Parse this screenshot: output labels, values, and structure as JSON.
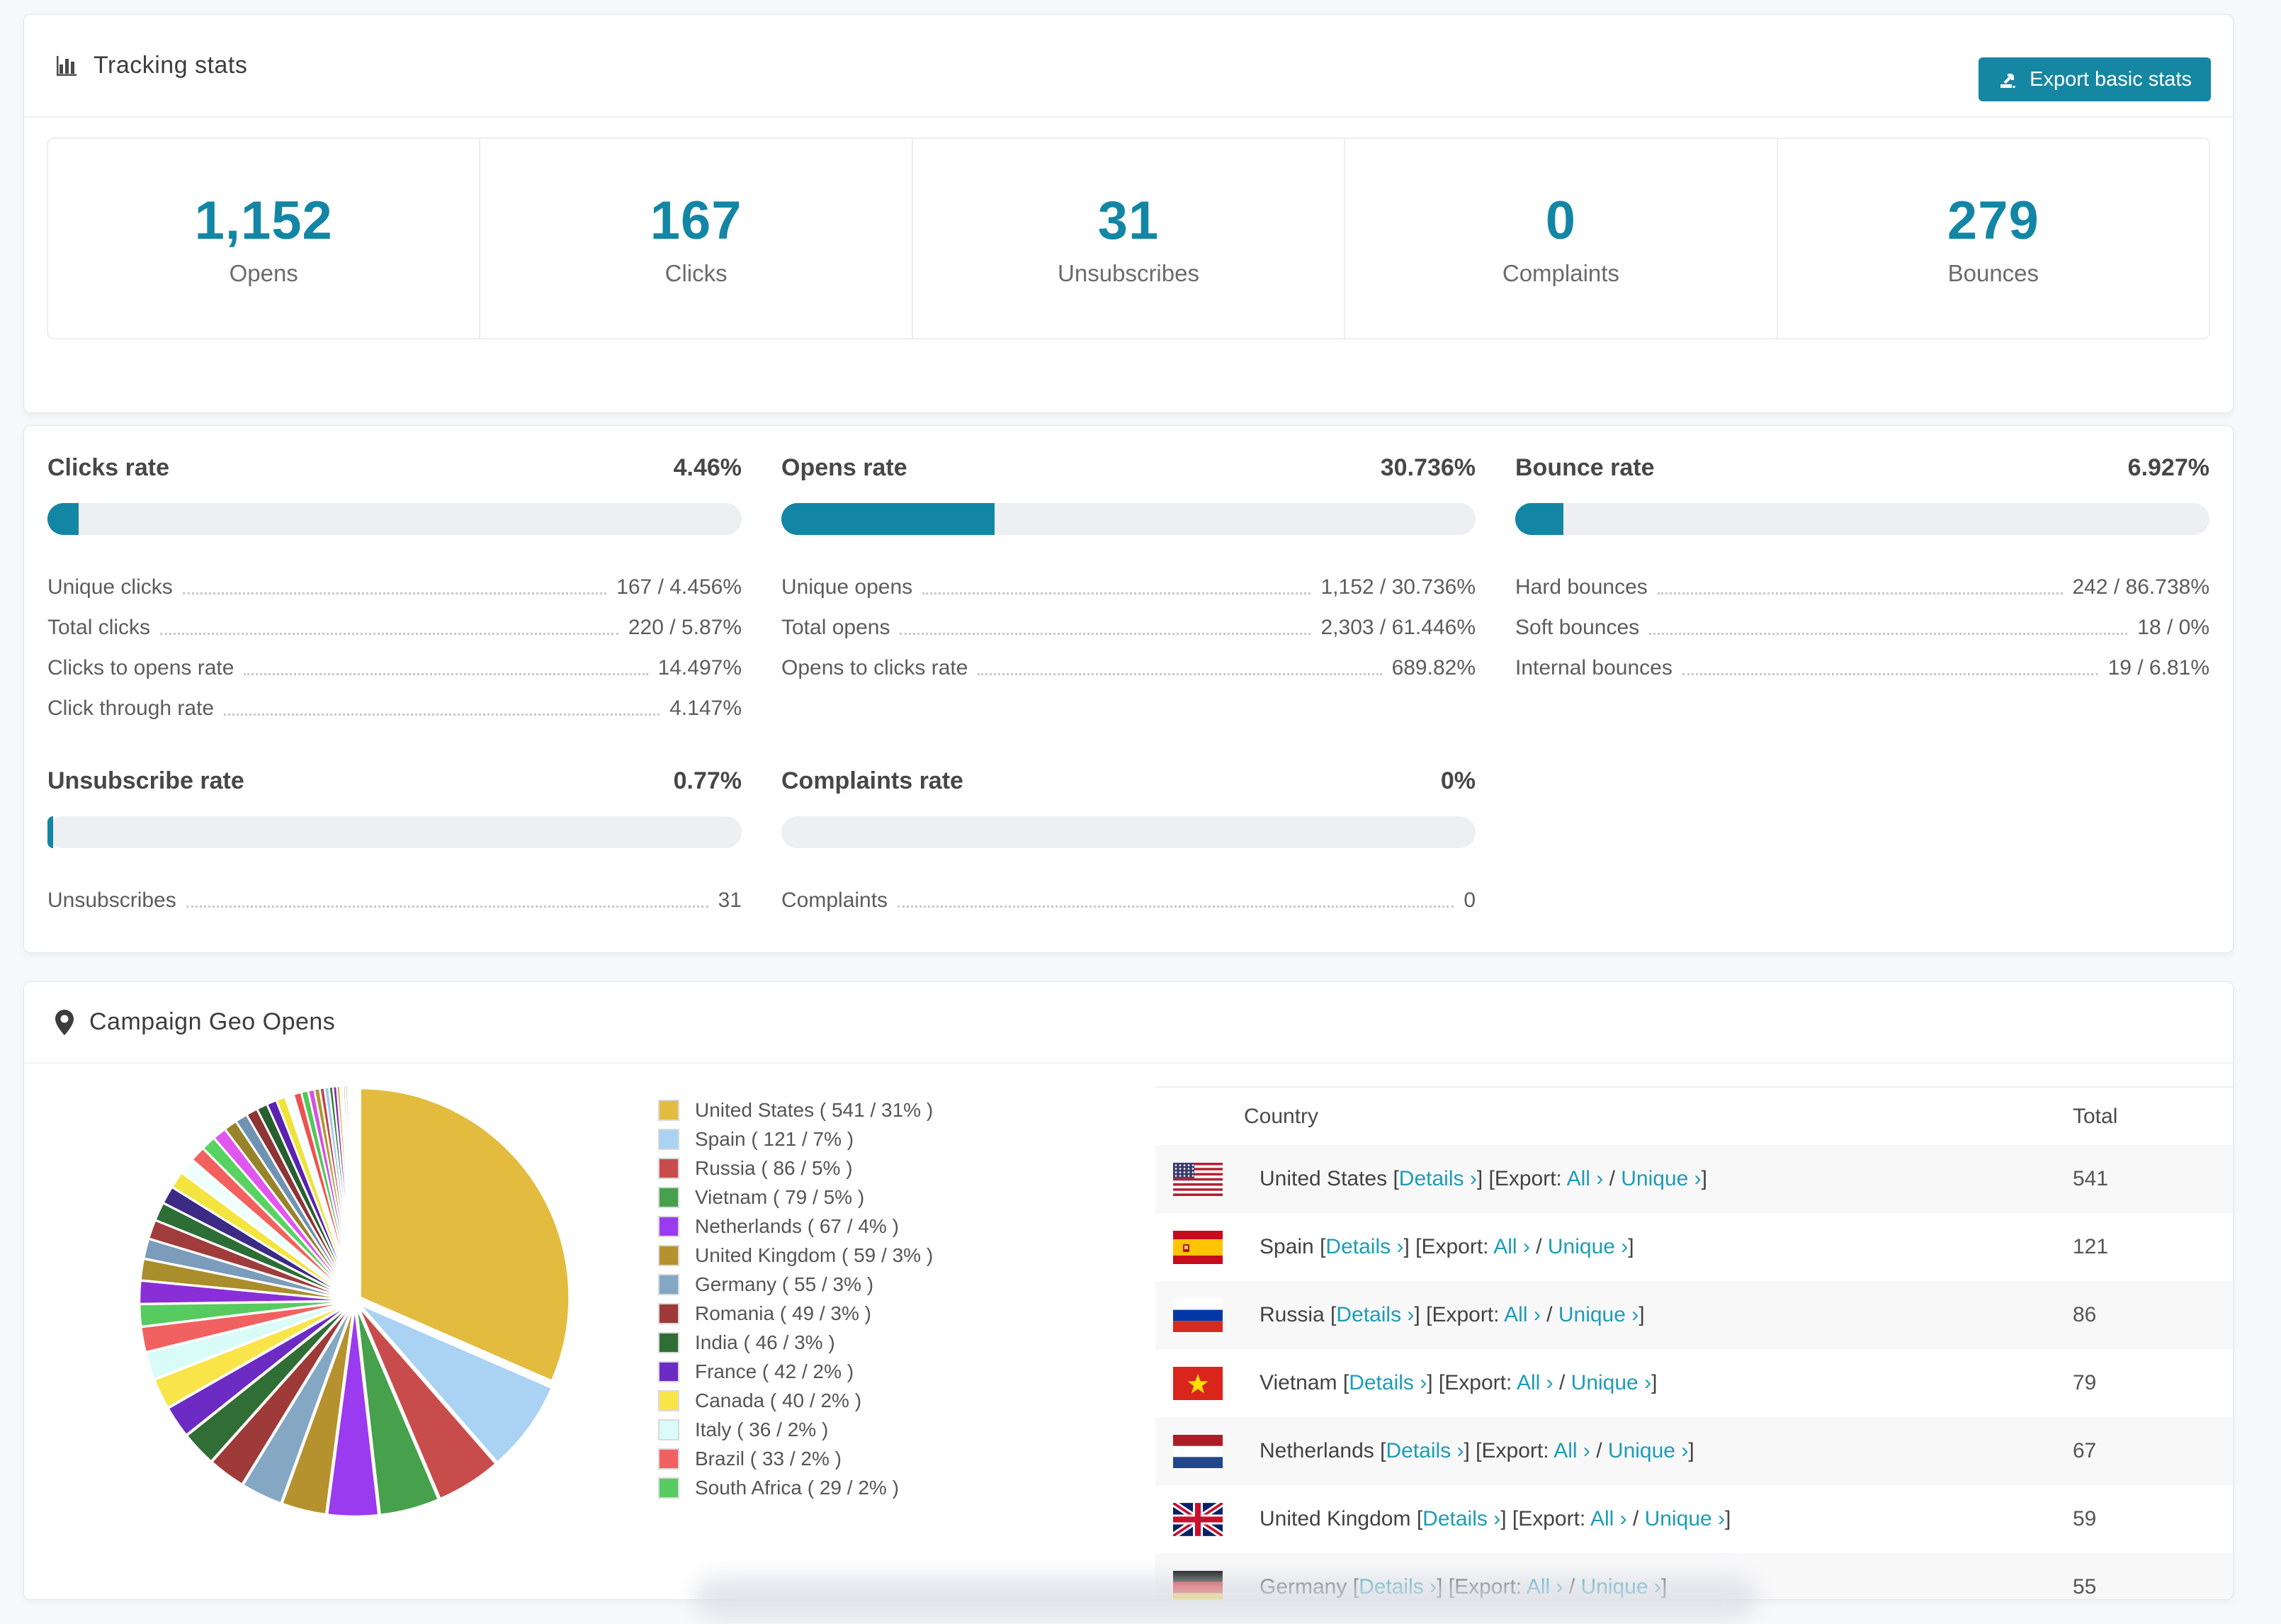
{
  "colors": {
    "teal": "#1286a4",
    "link_teal": "#1d9cb7",
    "bar_track": "#edeff2",
    "row_alt": "#f8f8f9"
  },
  "tracking": {
    "title": "Tracking stats",
    "export_button": "Export basic stats",
    "stats": [
      {
        "value": "1,152",
        "label": "Opens"
      },
      {
        "value": "167",
        "label": "Clicks"
      },
      {
        "value": "31",
        "label": "Unsubscribes"
      },
      {
        "value": "0",
        "label": "Complaints"
      },
      {
        "value": "279",
        "label": "Bounces"
      }
    ]
  },
  "rate_cards": [
    {
      "title": "Clicks rate",
      "value": "4.46%",
      "percent": 4.46,
      "rows": [
        {
          "label": "Unique clicks",
          "value": "167 / 4.456%"
        },
        {
          "label": "Total clicks",
          "value": "220 / 5.87%"
        },
        {
          "label": "Clicks to opens rate",
          "value": "14.497%"
        },
        {
          "label": "Click through rate",
          "value": "4.147%"
        }
      ]
    },
    {
      "title": "Opens rate",
      "value": "30.736%",
      "percent": 30.736,
      "rows": [
        {
          "label": "Unique opens",
          "value": "1,152 / 30.736%"
        },
        {
          "label": "Total opens",
          "value": "2,303 / 61.446%"
        },
        {
          "label": "Opens to clicks rate",
          "value": "689.82%"
        }
      ]
    },
    {
      "title": "Bounce rate",
      "value": "6.927%",
      "percent": 6.927,
      "rows": [
        {
          "label": "Hard bounces",
          "value": "242 / 86.738%"
        },
        {
          "label": "Soft bounces",
          "value": "18 / 0%"
        },
        {
          "label": "Internal bounces",
          "value": "19 / 6.81%"
        }
      ]
    },
    {
      "title": "Unsubscribe rate",
      "value": "0.77%",
      "percent": 0.77,
      "rows": [
        {
          "label": "Unsubscribes",
          "value": "31"
        }
      ]
    },
    {
      "title": "Complaints rate",
      "value": "0%",
      "percent": 0,
      "rows": [
        {
          "label": "Complaints",
          "value": "0"
        }
      ]
    }
  ],
  "geo": {
    "title": "Campaign Geo Opens",
    "table_headers": {
      "country": "Country",
      "total": "Total"
    },
    "link_labels": {
      "details": "Details",
      "export": "Export:",
      "all": "All",
      "unique": "Unique",
      "chevron": "›"
    },
    "rows": [
      {
        "country": "United States",
        "flag": "us",
        "total": "541"
      },
      {
        "country": "Spain",
        "flag": "es",
        "total": "121"
      },
      {
        "country": "Russia",
        "flag": "ru",
        "total": "86"
      },
      {
        "country": "Vietnam",
        "flag": "vn",
        "total": "79"
      },
      {
        "country": "Netherlands",
        "flag": "nl",
        "total": "67"
      },
      {
        "country": "United Kingdom",
        "flag": "gb",
        "total": "59"
      },
      {
        "country": "Germany",
        "flag": "de",
        "total": "55"
      }
    ]
  },
  "chart_data": {
    "type": "pie",
    "title": "Campaign Geo Opens",
    "legend_position": "right-of-pie",
    "start_angle_deg": -90,
    "direction": "clockwise",
    "slices": [
      {
        "label": "United States",
        "value": 541,
        "pct": "31%",
        "color": "#e3bb3f"
      },
      {
        "label": "Spain",
        "value": 121,
        "pct": "7%",
        "color": "#a9d2f3"
      },
      {
        "label": "Russia",
        "value": 86,
        "pct": "5%",
        "color": "#c94c4c"
      },
      {
        "label": "Vietnam",
        "value": 79,
        "pct": "5%",
        "color": "#46a04c"
      },
      {
        "label": "Netherlands",
        "value": 67,
        "pct": "4%",
        "color": "#9b3bf0"
      },
      {
        "label": "United Kingdom",
        "value": 59,
        "pct": "3%",
        "color": "#b6922e"
      },
      {
        "label": "Germany",
        "value": 55,
        "pct": "3%",
        "color": "#84a8c4"
      },
      {
        "label": "Romania",
        "value": 49,
        "pct": "3%",
        "color": "#9e3a38"
      },
      {
        "label": "India",
        "value": 46,
        "pct": "3%",
        "color": "#316e35"
      },
      {
        "label": "France",
        "value": 42,
        "pct": "2%",
        "color": "#6c2bc2"
      },
      {
        "label": "Canada",
        "value": 40,
        "pct": "2%",
        "color": "#f9e44a"
      },
      {
        "label": "Italy",
        "value": 36,
        "pct": "2%",
        "color": "#d9fcf8"
      },
      {
        "label": "Brazil",
        "value": 33,
        "pct": "2%",
        "color": "#f26161"
      },
      {
        "label": "South Africa",
        "value": 29,
        "pct": "2%",
        "color": "#57cb60"
      }
    ],
    "others_unlabeled": {
      "values": [
        30,
        28,
        26,
        25,
        24,
        23,
        22,
        21,
        20,
        19,
        18,
        17,
        16,
        15,
        14,
        13,
        12,
        11,
        10,
        9,
        8,
        7,
        6,
        6,
        5,
        5,
        4,
        4,
        3,
        3,
        2,
        2,
        2,
        1,
        1,
        1
      ],
      "colors": [
        "#8a2fd8",
        "#a98e2b",
        "#7b9cba",
        "#a03c3c",
        "#2d6d36",
        "#3c2b85",
        "#f3e53e",
        "#eefffc",
        "#f2615e",
        "#58d260",
        "#e156ee",
        "#97832a",
        "#6f93b2",
        "#8e3434",
        "#275f30",
        "#5b21b0",
        "#efe23a",
        "#f6fffe",
        "#ee5250",
        "#52c85a",
        "#d94fe0",
        "#b0972f",
        "#c24444",
        "#9ec9ef",
        "#2e7d32",
        "#8e24aa",
        "#c9a227",
        "#e8fcf9",
        "#ef9a9a",
        "#7ed685",
        "#cf8ef0",
        "#8d6e63",
        "#8aa8c0",
        "#bb5555",
        "#338833",
        "#651fff"
      ]
    }
  }
}
